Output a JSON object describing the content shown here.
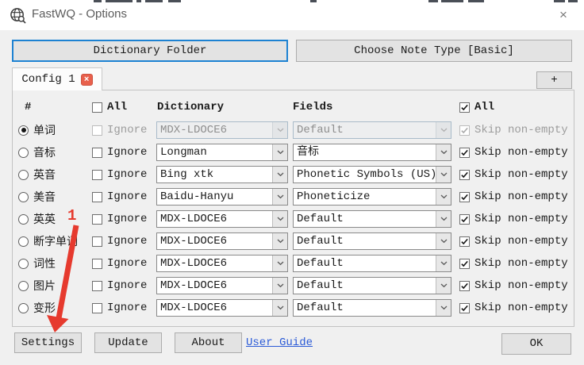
{
  "window": {
    "title": "FastWQ - Options",
    "close_glyph": "×"
  },
  "toolbar": {
    "dictionary_folder_label": "Dictionary Folder",
    "choose_note_type_label": "Choose Note Type [Basic]"
  },
  "tabs": {
    "active_label": "Config 1",
    "close_glyph": "×",
    "add_label": "+"
  },
  "table": {
    "headers": {
      "hash": "#",
      "ignore_all": "All",
      "dictionary": "Dictionary",
      "fields": "Fields",
      "skip_all": "All"
    },
    "ignore_all_checked": false,
    "skip_all_checked": true,
    "ignore_label": "Ignore",
    "skip_label": "Skip non-empty",
    "rows": [
      {
        "label": "单词",
        "selected": true,
        "disabled": true,
        "ignore_checked": false,
        "dictionary": "MDX-LDOCE6",
        "field": "Default",
        "skip_checked": true
      },
      {
        "label": "音标",
        "selected": false,
        "disabled": false,
        "ignore_checked": false,
        "dictionary": "Longman",
        "field": "音标",
        "skip_checked": true
      },
      {
        "label": "英音",
        "selected": false,
        "disabled": false,
        "ignore_checked": false,
        "dictionary": "Bing xtk",
        "field": "Phonetic Symbols (US)",
        "skip_checked": true
      },
      {
        "label": "美音",
        "selected": false,
        "disabled": false,
        "ignore_checked": false,
        "dictionary": "Baidu-Hanyu",
        "field": "Phoneticize",
        "skip_checked": true
      },
      {
        "label": "英英",
        "selected": false,
        "disabled": false,
        "ignore_checked": false,
        "dictionary": "MDX-LDOCE6",
        "field": "Default",
        "skip_checked": true
      },
      {
        "label": "断字单词",
        "selected": false,
        "disabled": false,
        "ignore_checked": false,
        "dictionary": "MDX-LDOCE6",
        "field": "Default",
        "skip_checked": true
      },
      {
        "label": "词性",
        "selected": false,
        "disabled": false,
        "ignore_checked": false,
        "dictionary": "MDX-LDOCE6",
        "field": "Default",
        "skip_checked": true
      },
      {
        "label": "图片",
        "selected": false,
        "disabled": false,
        "ignore_checked": false,
        "dictionary": "MDX-LDOCE6",
        "field": "Default",
        "skip_checked": true
      },
      {
        "label": "变形",
        "selected": false,
        "disabled": false,
        "ignore_checked": false,
        "dictionary": "MDX-LDOCE6",
        "field": "Default",
        "skip_checked": true
      }
    ]
  },
  "footer": {
    "settings_label": "Settings",
    "update_label": "Update",
    "about_label": "About",
    "user_guide_label": "User Guide",
    "ok_label": "OK"
  },
  "annotation": {
    "number": "1",
    "color": "#e63a2e"
  },
  "colors": {
    "focus_border": "#1d82d2",
    "link": "#2a5ad7",
    "tab_close_bg": "#e8604c"
  }
}
